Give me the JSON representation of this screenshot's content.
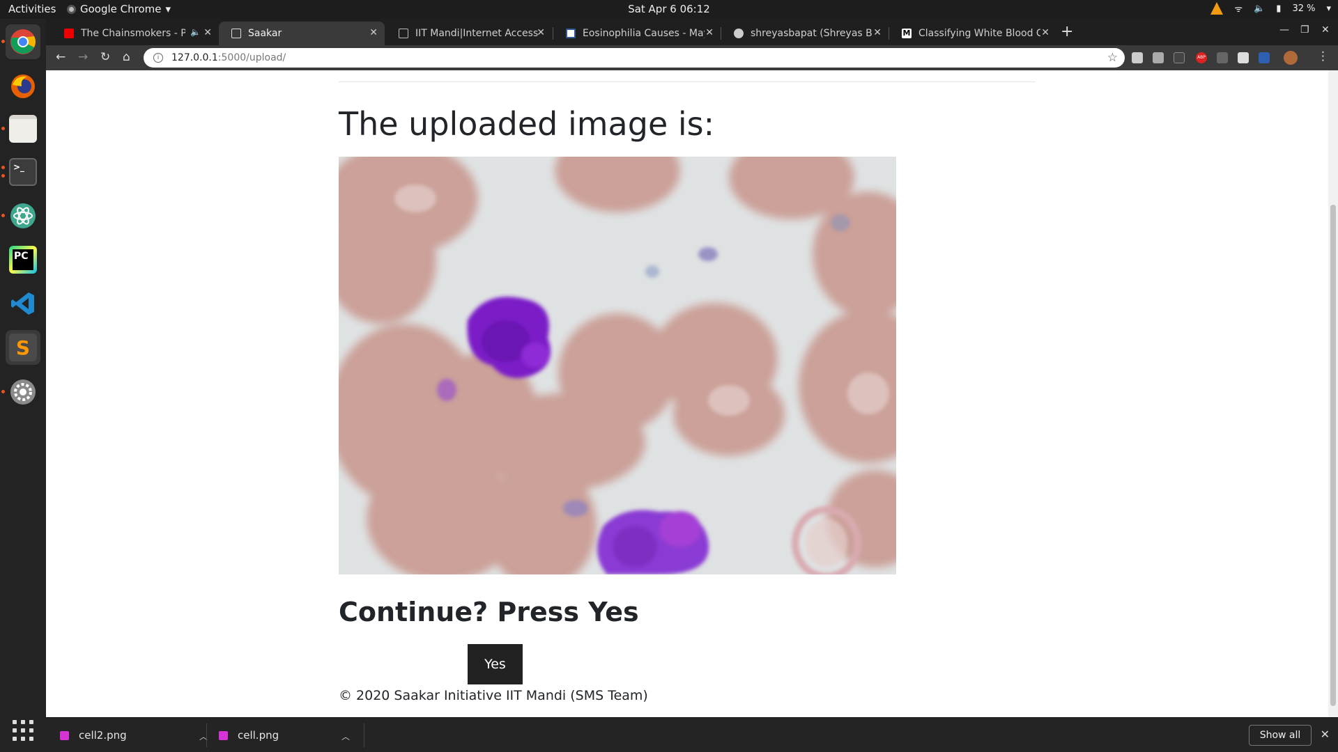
{
  "topbar": {
    "activities": "Activities",
    "app_name": "Google Chrome",
    "clock": "Sat Apr 6  06:12",
    "battery": "32 %"
  },
  "dock": {
    "apps": [
      "Chrome",
      "Firefox",
      "Files",
      "Terminal",
      "Atom",
      "PyCharm",
      "VS Code",
      "Sublime Text",
      "Settings"
    ]
  },
  "tabs": [
    {
      "title": "The Chainsmokers - Pa",
      "favicon": "youtube-icon"
    },
    {
      "title": "Saakar",
      "favicon": "page-icon"
    },
    {
      "title": "IIT Mandi|Internet Access",
      "favicon": "page-icon"
    },
    {
      "title": "Eosinophilia Causes - May",
      "favicon": "mayo-icon"
    },
    {
      "title": "shreyasbapat (Shreyas Ba",
      "favicon": "github-icon"
    },
    {
      "title": "Classifying White Blood C",
      "favicon": "medium-icon"
    }
  ],
  "toolbar": {
    "url_host": "127.0.0.1",
    "url_path": ":5000/upload/"
  },
  "page": {
    "title": "The uploaded image is:",
    "continue_text": "Continue? Press Yes",
    "yes_label": "Yes",
    "footer": "© 2020 Saakar Initiative IIT Mandi (SMS Team)"
  },
  "downloads": [
    {
      "name": "cell2.png"
    },
    {
      "name": "cell.png"
    }
  ],
  "shelf": {
    "show_all": "Show all"
  },
  "colors": {
    "accent": "#e95420",
    "button": "#222222"
  }
}
